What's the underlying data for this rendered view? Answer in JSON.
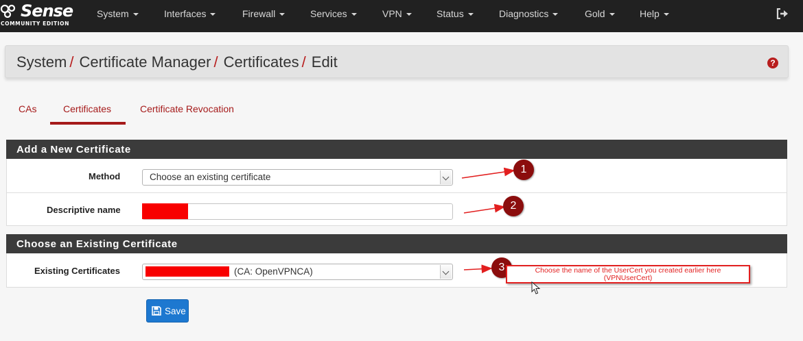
{
  "navbar": {
    "logo_text": "Sense",
    "logo_edition": "COMMUNITY EDITION",
    "items": [
      {
        "label": "System"
      },
      {
        "label": "Interfaces"
      },
      {
        "label": "Firewall"
      },
      {
        "label": "Services"
      },
      {
        "label": "VPN"
      },
      {
        "label": "Status"
      },
      {
        "label": "Diagnostics"
      },
      {
        "label": "Gold"
      },
      {
        "label": "Help"
      }
    ],
    "logout_icon": "sign-out-icon"
  },
  "breadcrumb": {
    "parts": [
      "System",
      "Certificate Manager",
      "Certificates",
      "Edit"
    ],
    "separator": "/"
  },
  "help_icon": "question-circle-icon",
  "tabs": [
    {
      "label": "CAs",
      "active": false
    },
    {
      "label": "Certificates",
      "active": true
    },
    {
      "label": "Certificate Revocation",
      "active": false
    }
  ],
  "panel_new": {
    "title": "Add a New Certificate",
    "method_label": "Method",
    "method_value": "Choose an existing certificate",
    "descr_label": "Descriptive name",
    "descr_value": ""
  },
  "panel_existing": {
    "title": "Choose an Existing Certificate",
    "existing_label": "Existing Certificates",
    "existing_value_suffix": "(CA: OpenVPNCA)"
  },
  "save_button": {
    "label": "Save",
    "icon": "floppy-disk-icon"
  },
  "annotations": {
    "markers": [
      "1",
      "2",
      "3"
    ],
    "note_line1": "Choose the name of the UserCert you created earlier here",
    "note_line2": "(VPNUserCert)"
  },
  "colors": {
    "navbar": "#212121",
    "accent": "#a51a1a",
    "panel_header": "#3b3b3b",
    "button": "#1d78d0",
    "redaction": "#f80000"
  }
}
